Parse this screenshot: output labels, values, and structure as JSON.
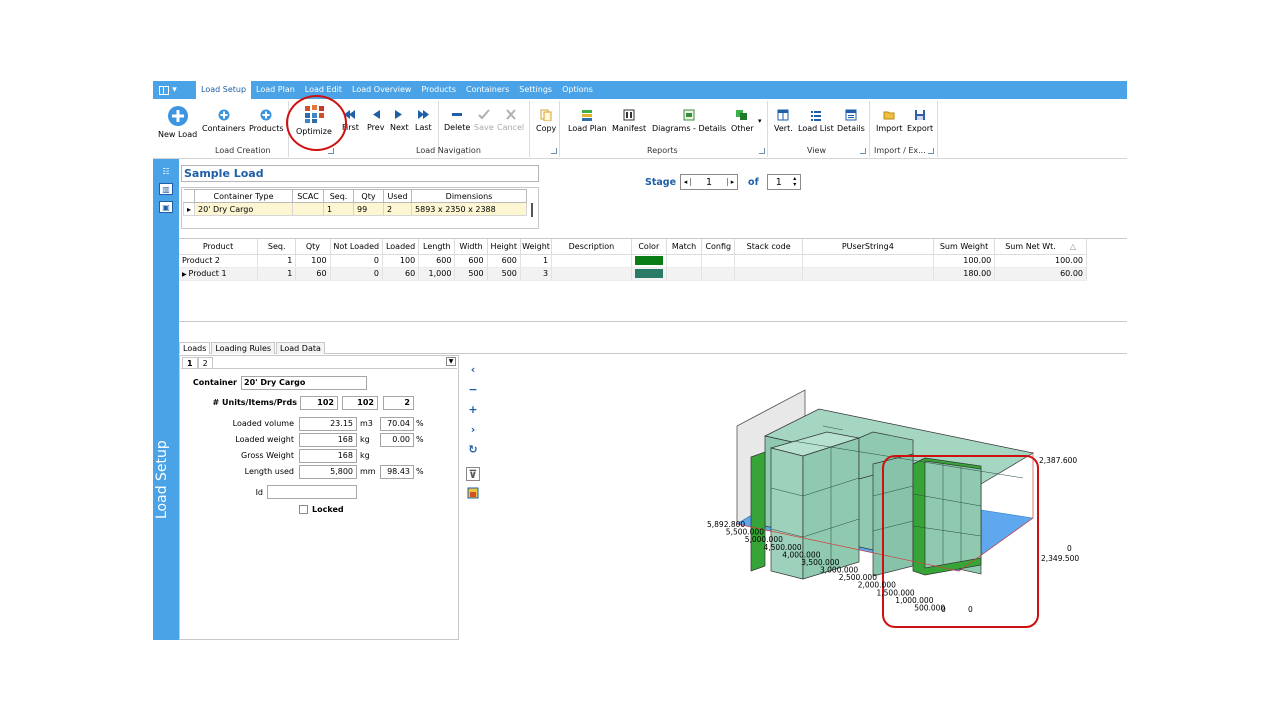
{
  "menubar": {
    "tabs": [
      "Load Setup",
      "Load Plan",
      "Load Edit",
      "Load Overview",
      "Products",
      "Containers",
      "Settings",
      "Options"
    ],
    "active_tab": "Load Setup"
  },
  "ribbon": {
    "new_load": "New Load",
    "containers": "Containers",
    "products": "Products",
    "optimize": "Optimize",
    "first": "First",
    "prev": "Prev",
    "next": "Next",
    "last": "Last",
    "delete": "Delete",
    "save": "Save",
    "cancel": "Cancel",
    "copy": "Copy",
    "load_plan": "Load Plan",
    "manifest": "Manifest",
    "diagrams_details": "Diagrams - Details",
    "other": "Other",
    "vert": "Vert.",
    "load_list": "Load List",
    "details": "Details",
    "import": "Import",
    "export": "Export",
    "groups": {
      "load_creation": "Load Creation",
      "load_navigation": "Load Navigation",
      "reports": "Reports",
      "view": "View",
      "import_export": "Import / Ex..."
    }
  },
  "sidebar": {
    "title": "Load Setup"
  },
  "load": {
    "name": "Sample Load"
  },
  "container_grid": {
    "headers": [
      "Container Type",
      "SCAC",
      "Seq.",
      "Qty",
      "Used",
      "Dimensions"
    ],
    "rows": [
      [
        "20' Dry Cargo",
        "",
        "1",
        "99",
        "2",
        "5893 x 2350 x 2388"
      ]
    ]
  },
  "stage": {
    "label": "Stage",
    "value": "1",
    "of_label": "of",
    "total": "1"
  },
  "product_grid": {
    "headers": [
      "Product",
      "Seq.",
      "Qty",
      "Not Loaded",
      "Loaded",
      "Length",
      "Width",
      "Height",
      "Weight",
      "Description",
      "Color",
      "Match",
      "Config",
      "Stack code",
      "PUserString4",
      "Sum Weight",
      "Sum Net Wt."
    ],
    "rows": [
      {
        "cells": [
          "Product 2",
          "1",
          "100",
          "0",
          "100",
          "600",
          "600",
          "600",
          "1",
          "",
          "",
          "",
          "",
          "",
          "",
          "100.00",
          "100.00"
        ],
        "color": "#0a7d15"
      },
      {
        "cells": [
          "Product 1",
          "1",
          "60",
          "0",
          "60",
          "1,000",
          "500",
          "500",
          "3",
          "",
          "",
          "",
          "",
          "",
          "",
          "180.00",
          "60.00"
        ],
        "color": "#2a7a68"
      }
    ]
  },
  "bottom_tabs": [
    "Loads",
    "Loading Rules",
    "Load Data"
  ],
  "sub_tabs": [
    "1",
    "2"
  ],
  "details": {
    "container_label": "Container",
    "container_value": "20' Dry Cargo",
    "units_label": "# Units/Items/Prds",
    "units": "102",
    "items": "102",
    "prds": "2",
    "loaded_volume_label": "Loaded volume",
    "loaded_volume": "23.15",
    "loaded_volume_unit": "m3",
    "loaded_volume_pct": "70.04",
    "loaded_weight_label": "Loaded weight",
    "loaded_weight": "168",
    "loaded_weight_unit": "kg",
    "loaded_weight_pct": "0.00",
    "gross_weight_label": "Gross Weight",
    "gross_weight": "168",
    "gross_weight_unit": "kg",
    "length_used_label": "Length used",
    "length_used": "5,800",
    "length_used_unit": "mm",
    "length_used_pct": "98.43",
    "pct": "%",
    "id_label": "Id",
    "id_value": "",
    "locked_label": "Locked"
  },
  "view3d": {
    "height_max": "2,387.600",
    "width_max": "2,349.500",
    "width_zero": "0",
    "length_ticks": [
      "5,892.800",
      "5,500.000",
      "5,000.000",
      "4,500.000",
      "4,000.000",
      "3,500.000",
      "3,000.000",
      "2,500.000",
      "2,000.000",
      "1,500.000",
      "1,000.000",
      "500.000",
      "0"
    ],
    "origin": "0"
  },
  "colors": {
    "accent": "#4aa3e6",
    "box_teal": "#8ec9b0",
    "box_green": "#36a436",
    "floor": "#5fa8f0",
    "highlight": "#d01010"
  }
}
